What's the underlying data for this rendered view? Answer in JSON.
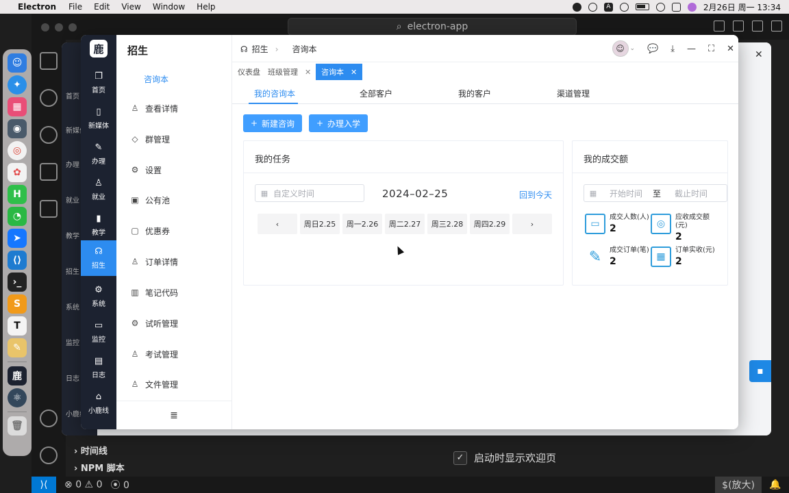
{
  "menubar": {
    "app": "Electron",
    "menus": [
      "File",
      "Edit",
      "View",
      "Window",
      "Help"
    ],
    "clock": "2月26日 周一  13:34",
    "a_badge": "A"
  },
  "vscode": {
    "search": "electron-app",
    "panel_items": [
      "时间线",
      "NPM 脚本"
    ],
    "welcome_label": "启动时显示欢迎页",
    "status_errors": "0",
    "status_warnings": "0",
    "status_ports": "0",
    "status_zoom": "$(放大)"
  },
  "app": {
    "logo": "鹿",
    "nav": [
      {
        "label": "首页",
        "icon": "copy-icon"
      },
      {
        "label": "新媒体",
        "icon": "phone-icon"
      },
      {
        "label": "办理",
        "icon": "pen-icon"
      },
      {
        "label": "就业",
        "icon": "person-icon"
      },
      {
        "label": "教学",
        "icon": "bottle-icon"
      },
      {
        "label": "招生",
        "icon": "headset-icon"
      },
      {
        "label": "系统",
        "icon": "gear-icon"
      },
      {
        "label": "监控",
        "icon": "monitor-icon"
      },
      {
        "label": "日志",
        "icon": "log-icon"
      },
      {
        "label": "小鹿线",
        "icon": "home-icon"
      }
    ],
    "sub": {
      "title": "招生",
      "active": "咨询本",
      "items": [
        "查看详情",
        "群管理",
        "设置",
        "公有池",
        "优惠券",
        "订单详情",
        "笔记代码",
        "试听管理",
        "考试管理",
        "文件管理"
      ]
    },
    "breadcrumb": [
      "招生",
      "咨询本"
    ],
    "tags": [
      {
        "label": "仪表盘"
      },
      {
        "label": "班级管理"
      },
      {
        "label": "咨询本"
      }
    ],
    "subtabs": [
      "我的咨询本",
      "全部客户",
      "我的客户",
      "渠道管理"
    ],
    "buttons": {
      "new": "新建咨询",
      "enroll": "办理入学"
    },
    "tasks": {
      "title": "我的任务",
      "placeholder": "自定义时间",
      "date": "2024–02–25",
      "today": "回到今天",
      "prev": "‹",
      "next": "›",
      "days": [
        "周日2.25",
        "周一2.26",
        "周二2.27",
        "周三2.28",
        "周四2.29"
      ]
    },
    "deals": {
      "title": "我的成交额",
      "start": "开始时间",
      "to": "至",
      "end": "截止时间",
      "stats": [
        {
          "label": "成交人数(人)",
          "value": "2"
        },
        {
          "label": "应收成交额(元)",
          "value": "2"
        },
        {
          "label": "成交订单(笔)",
          "value": "2"
        },
        {
          "label": "订单实收(元)",
          "value": "2"
        }
      ]
    }
  }
}
